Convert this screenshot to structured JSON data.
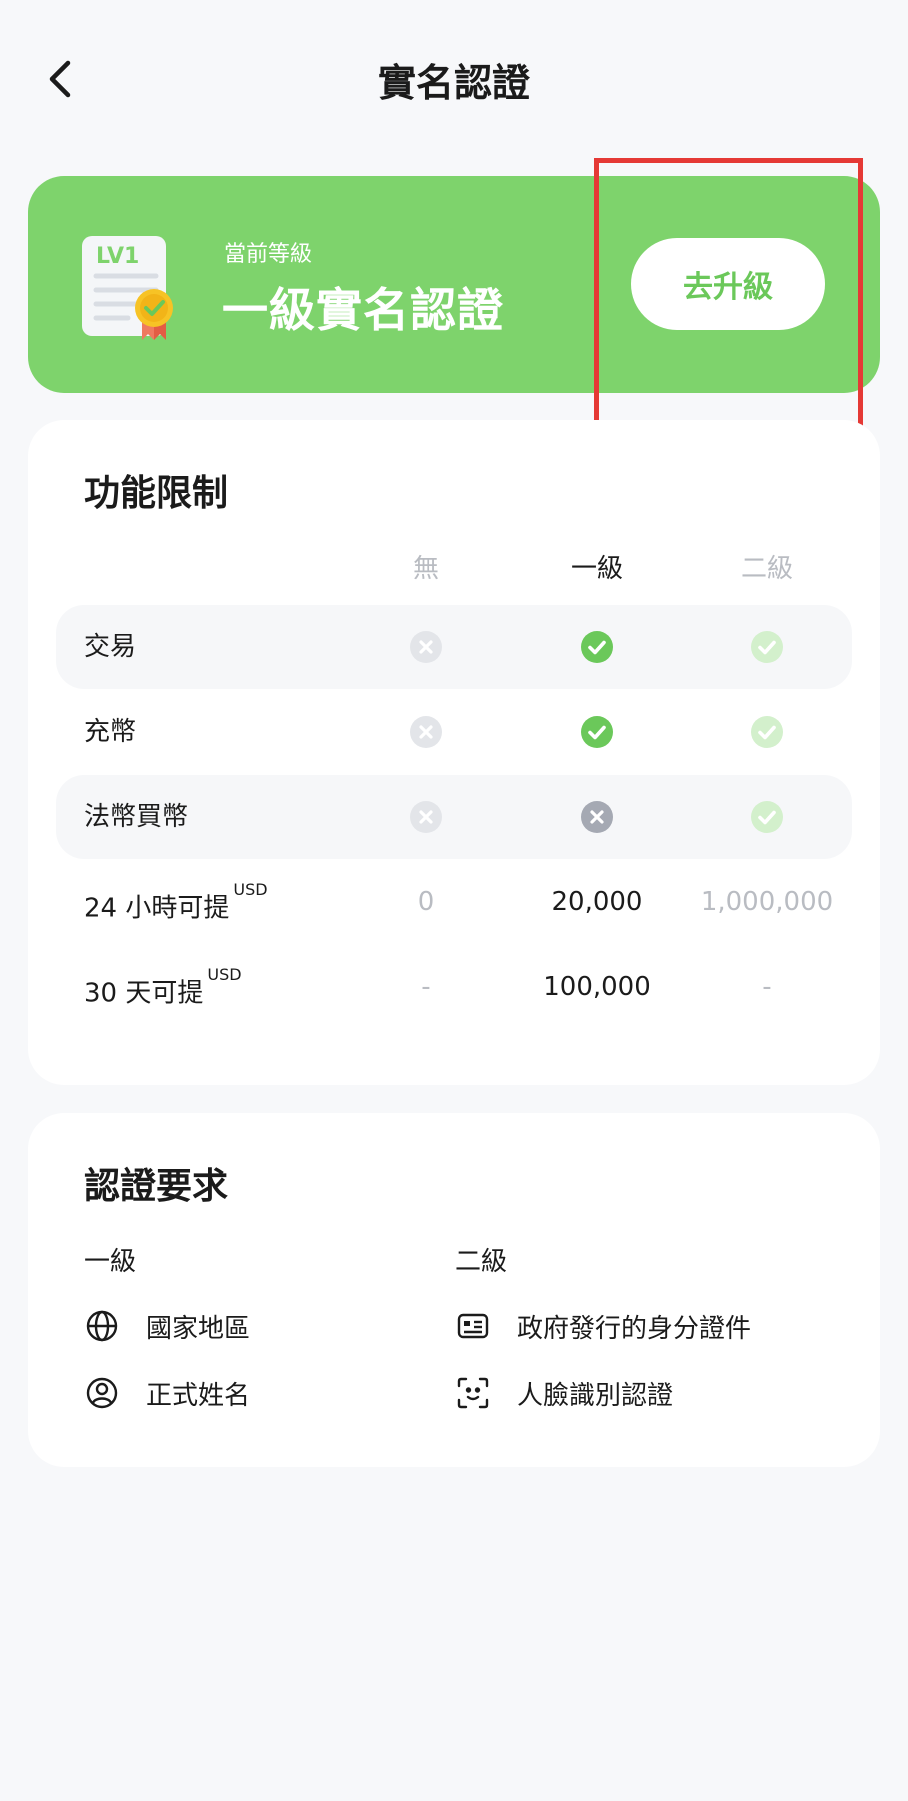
{
  "header": {
    "title": "實名認證",
    "back_icon": "chevron-left-icon"
  },
  "level_card": {
    "badge_text": "LV1",
    "caption": "當前等級",
    "level_name": "一級實名認證",
    "upgrade_label": "去升級",
    "background_color": "#7ed36c",
    "highlight_color": "#e53935"
  },
  "limits": {
    "title": "功能限制",
    "columns": [
      "無",
      "一級",
      "二級"
    ],
    "rows": [
      {
        "label": "交易",
        "unit": "",
        "values": [
          "x",
          "check",
          "check"
        ],
        "shaded": true
      },
      {
        "label": "充幣",
        "unit": "",
        "values": [
          "x",
          "check",
          "check"
        ],
        "shaded": false
      },
      {
        "label": "法幣買幣",
        "unit": "",
        "values": [
          "x",
          "x",
          "check"
        ],
        "shaded": true
      },
      {
        "label": "24 小時可提",
        "unit": "USD",
        "values": [
          "0",
          "20,000",
          "1,000,000"
        ],
        "shaded": false
      },
      {
        "label": "30 天可提",
        "unit": "USD",
        "values": [
          "-",
          "100,000",
          "-"
        ],
        "shaded": false
      }
    ]
  },
  "requirements": {
    "title": "認證要求",
    "level1": {
      "label": "一級",
      "items": [
        {
          "icon": "globe-icon",
          "text": "國家地區"
        },
        {
          "icon": "user-circle-icon",
          "text": "正式姓名"
        }
      ]
    },
    "level2": {
      "label": "二級",
      "items": [
        {
          "icon": "id-card-icon",
          "text": "政府發行的身分證件"
        },
        {
          "icon": "face-scan-icon",
          "text": "人臉識別認證"
        }
      ]
    }
  }
}
